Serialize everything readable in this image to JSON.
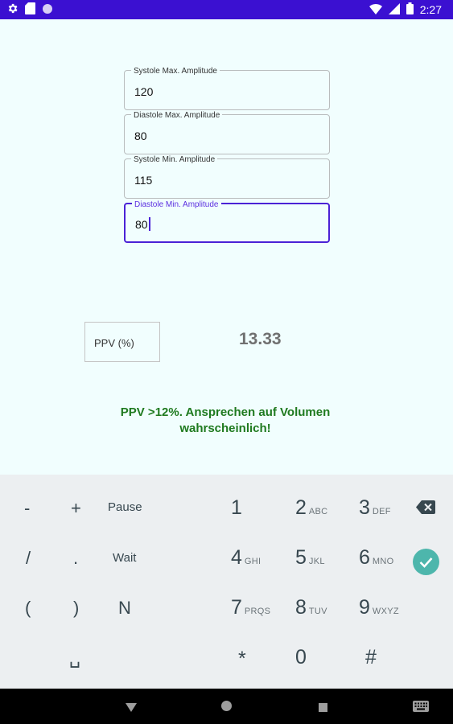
{
  "status_bar": {
    "time": "2:27",
    "left_icons": [
      "gear-icon",
      "sd-card-icon",
      "circle-icon"
    ],
    "right_icons": [
      "wifi-icon",
      "signal-icon",
      "battery-icon"
    ]
  },
  "form": {
    "fields": [
      {
        "label": "Systole Max. Amplitude",
        "value": "120"
      },
      {
        "label": "Diastole Max. Amplitude",
        "value": "80"
      },
      {
        "label": "Systole Min. Amplitude",
        "value": "115"
      },
      {
        "label": "Diastole Min. Amplitude",
        "value": "80"
      }
    ]
  },
  "result": {
    "label": "PPV (%)",
    "value": "13.33",
    "message_line1": "PPV >12%. Ansprechen auf Volumen",
    "message_line2": "wahrscheinlich!",
    "message_color": "#1f7a1f"
  },
  "keyboard": {
    "row1": {
      "k1": "-",
      "k2": "+",
      "k3": "Pause",
      "d1": "1",
      "d2": "2",
      "l2": "ABC",
      "d3": "3",
      "l3": "DEF"
    },
    "row2": {
      "k1": "/",
      "k2": ".",
      "k3": "Wait",
      "d1": "4",
      "l1": "GHI",
      "d2": "5",
      "l2": "JKL",
      "d3": "6",
      "l3": "MNO"
    },
    "row3": {
      "k1": "(",
      "k2": ")",
      "k3": "N",
      "d1": "7",
      "l1": "PRQS",
      "d2": "8",
      "l2": "TUV",
      "d3": "9",
      "l3": "WXYZ"
    },
    "row4": {
      "k1": "␣",
      "d1": "*",
      "d2": "0",
      "d3": "#"
    }
  },
  "colors": {
    "status_bar": "#3b10d1",
    "background": "#f1fefe",
    "accent": "#4b22d6",
    "done_key": "#4db6ac"
  }
}
